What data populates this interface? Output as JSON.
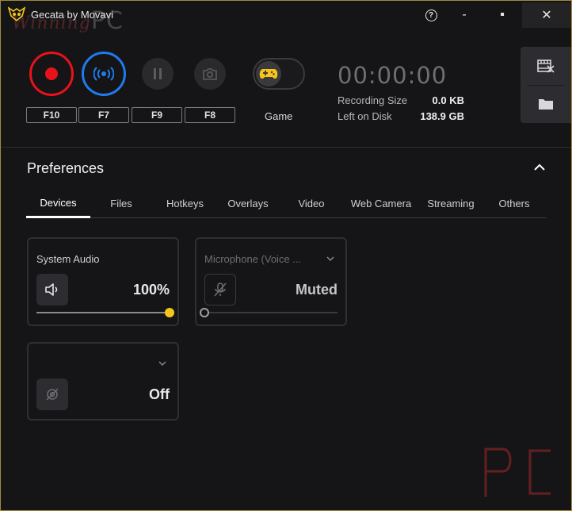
{
  "window": {
    "title": "Gecata by Movavi",
    "watermark_text": "Winning",
    "watermark_pc": "PC",
    "help_glyph": "?",
    "minimize_glyph": "-",
    "maximize_glyph": "▪",
    "close_glyph": "✕"
  },
  "hotkeys": {
    "record": "F10",
    "stream": "F7",
    "pause": "F9",
    "screenshot": "F8"
  },
  "game_mode": {
    "label": "Game",
    "enabled": false
  },
  "timer": "00:00:00",
  "stats": {
    "recording_size_label": "Recording Size",
    "recording_size_value": "0.0 KB",
    "left_on_disk_label": "Left on Disk",
    "left_on_disk_value": "138.9 GB"
  },
  "preferences": {
    "title": "Preferences",
    "tabs": [
      {
        "label": "Devices",
        "active": true
      },
      {
        "label": "Files"
      },
      {
        "label": "Hotkeys"
      },
      {
        "label": "Overlays"
      },
      {
        "label": "Video"
      },
      {
        "label": "Web Camera"
      },
      {
        "label": "Streaming"
      },
      {
        "label": "Others"
      }
    ]
  },
  "devices": {
    "system_audio": {
      "title": "System Audio",
      "value": "100%",
      "level": 1.0
    },
    "microphone": {
      "title": "Microphone (Voice ...",
      "value": "Muted",
      "level": 0.0
    },
    "webcam": {
      "title": "",
      "value": "Off"
    }
  },
  "colors": {
    "record": "#e8121b",
    "stream": "#1f7bf0",
    "accent_yellow": "#f5c518",
    "background": "#151517"
  }
}
